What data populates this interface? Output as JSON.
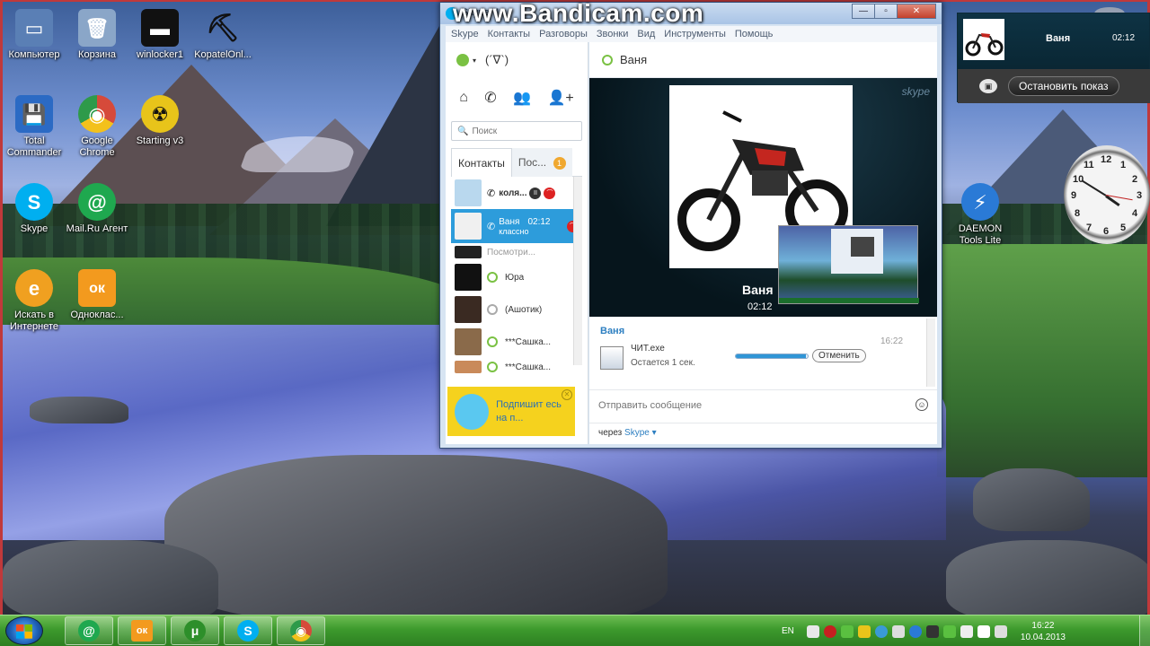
{
  "watermark": "www.Bandicam.com",
  "window": {
    "title": "Skype™"
  },
  "desktop": {
    "icons": [
      {
        "name": "computer",
        "label": "Компьютер",
        "color": "#5a7fb5",
        "glyph": "▭"
      },
      {
        "name": "recycle-bin",
        "label": "Корзина",
        "color": "#8aa6c8",
        "glyph": "🗑"
      },
      {
        "name": "winlocker",
        "label": "winlocker1",
        "color": "#111111",
        "glyph": "▬"
      },
      {
        "name": "kopatel",
        "label": "KopatelOnl...",
        "color": "transparent",
        "glyph": "⛏"
      },
      {
        "name": "total-commander",
        "label": "Total Commander",
        "color": "#2b6ac4",
        "glyph": "💾"
      },
      {
        "name": "chrome",
        "label": "Google Chrome",
        "color": "#d64a3a",
        "glyph": "◉"
      },
      {
        "name": "starting",
        "label": "Starting v3",
        "color": "#e8c41a",
        "glyph": "☢"
      },
      {
        "name": "skype",
        "label": "Skype",
        "color": "#00aff0",
        "glyph": "S"
      },
      {
        "name": "mailru",
        "label": "Mail.Ru Агент",
        "color": "#1fa84f",
        "glyph": "@"
      },
      {
        "name": "search-internet",
        "label": "Искать в Интернете",
        "color": "#f0a020",
        "glyph": "e"
      },
      {
        "name": "odnoklassniki",
        "label": "Одноклас...",
        "color": "#f39a1e",
        "glyph": "ок"
      },
      {
        "name": "daemon-tools",
        "label": "DAEMON Tools Lite",
        "color": "#2a7ad6",
        "glyph": "⚡"
      }
    ]
  },
  "skype": {
    "menu": [
      "Skype",
      "Контакты",
      "Разговоры",
      "Звонки",
      "Вид",
      "Инструменты",
      "Помощь"
    ],
    "status_text": "(´∇`)",
    "search_placeholder": "Поиск",
    "tabs": {
      "contacts": "Контакты",
      "recent": "Пос...",
      "recent_badge": "1"
    },
    "contacts": [
      {
        "name": "коля...",
        "selected": false
      },
      {
        "name": "Ваня",
        "time": "02:12",
        "mood": "классно",
        "selected": true
      },
      {
        "name": "Посмотри...",
        "selected": false
      },
      {
        "name": "Юра",
        "selected": false
      },
      {
        "name": "(Ашотик)",
        "selected": false
      },
      {
        "name": "***Сашка...",
        "selected": false
      },
      {
        "name": "***Сашка...",
        "selected": false
      }
    ],
    "promo_text": "Подпишит есь на п...",
    "chat": {
      "contact": "Ваня",
      "video_name": "Ваня",
      "video_time": "02:12",
      "video_logo": "skype",
      "transfer": {
        "from": "Ваня",
        "file": "ЧИТ.exe",
        "remaining": "Остается 1 сек.",
        "progress": 0.97,
        "cancel_label": "Отменить",
        "time": "16:22"
      },
      "compose_placeholder": "Отправить сообщение",
      "via_prefix": "через",
      "via_service": "Skype ▾"
    }
  },
  "share_widget": {
    "name": "Ваня",
    "time": "02:12",
    "stop_label": "Остановить показ"
  },
  "clock": {
    "numbers": [
      "12",
      "1",
      "2",
      "3",
      "4",
      "5",
      "6",
      "7",
      "8",
      "9",
      "10",
      "11"
    ]
  },
  "taskbar": {
    "apps": [
      {
        "name": "mailru",
        "color": "#1fa84f",
        "glyph": "@"
      },
      {
        "name": "odnoklassniki",
        "color": "#f39a1e",
        "glyph": "ок"
      },
      {
        "name": "utorrent",
        "color": "#2d8f2a",
        "glyph": "μ"
      },
      {
        "name": "skype",
        "color": "#00aff0",
        "glyph": "S"
      },
      {
        "name": "chrome",
        "color": "#d64a3a",
        "glyph": "◉"
      }
    ],
    "lang": "EN",
    "time": "16:22",
    "date": "10.04.2013",
    "tray_colors": [
      "#e8e8e8",
      "#c62020",
      "#5ac040",
      "#e8c41a",
      "#3a9ad6",
      "#dddddd",
      "#2a7ad6",
      "#333333",
      "#5ac040",
      "#eeeeee",
      "#ffffff",
      "#dddddd"
    ]
  }
}
